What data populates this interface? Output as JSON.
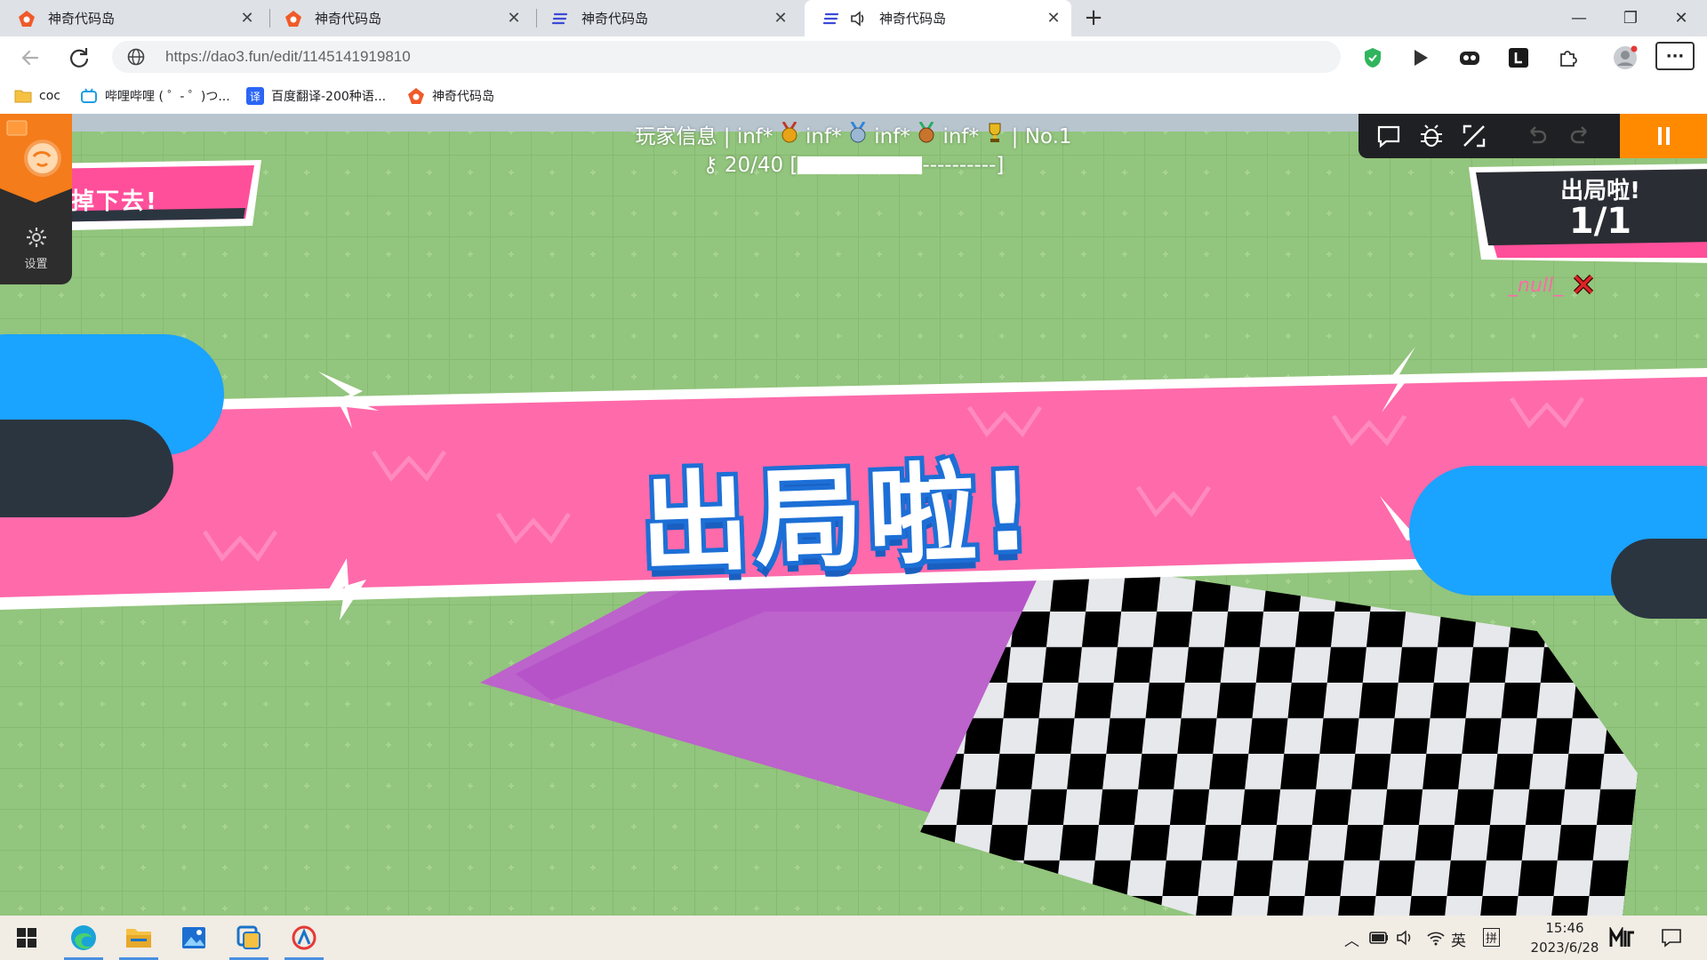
{
  "browser": {
    "tabs": [
      {
        "title": "神奇代码岛",
        "favicon": "dao3-icon",
        "active": false
      },
      {
        "title": "神奇代码岛",
        "favicon": "dao3-icon",
        "active": false
      },
      {
        "title": "神奇代码岛",
        "favicon": "doc-lines-icon",
        "active": false
      },
      {
        "title": "神奇代码岛",
        "favicon": "doc-lines-icon",
        "active": true,
        "audio": true
      }
    ],
    "close_glyph": "✕",
    "new_tab_glyph": "+",
    "window_controls": {
      "minimize": "—",
      "restore": "❐",
      "close": "✕"
    },
    "url": "https://dao3.fun/edit/1145141919810",
    "more_glyph": "···"
  },
  "bookmarks": [
    {
      "label": "coc",
      "icon": "folder-icon"
    },
    {
      "label": "哔哩哔哩 ( ゜- ゜)つ...",
      "icon": "bilibili-icon"
    },
    {
      "label": "百度翻译-200种语...",
      "icon": "translate-icon"
    },
    {
      "label": "神奇代码岛",
      "icon": "dao3-icon"
    }
  ],
  "game": {
    "player_info": {
      "prefix": "玩家信息 | ",
      "medals": [
        {
          "text": "inf*",
          "color": "#e8a317"
        },
        {
          "text": "inf*",
          "color": "#9bb7d4"
        },
        {
          "text": "inf*",
          "color": "#c8742c"
        },
        {
          "text": "inf*",
          "color": "#e8b820"
        }
      ],
      "rank": "| No.1"
    },
    "progress": {
      "prefix": "20/40 [",
      "tail": "----------]",
      "value": 20,
      "max": 40
    },
    "left_banner_text": "掉下去!",
    "left_menu": {
      "settings_label": "设置"
    },
    "out_card": {
      "title": "出局啦!",
      "count": "1/1"
    },
    "eliminated_player": "_null_",
    "banner_text": "出局啦!",
    "colors": {
      "pink": "#ff6aaa",
      "blue": "#1aa3ff",
      "orange": "#ff8a00",
      "grass": "#8fc47a"
    }
  },
  "taskbar": {
    "apps": [
      "windows-start-icon",
      "edge-icon",
      "file-explorer-icon",
      "photos-icon",
      "app-square-icon",
      "dao3-icon"
    ],
    "tray": {
      "ime_lang": "英",
      "ime_mode": "拼"
    },
    "time": "15:46",
    "date": "2023/6/28"
  }
}
